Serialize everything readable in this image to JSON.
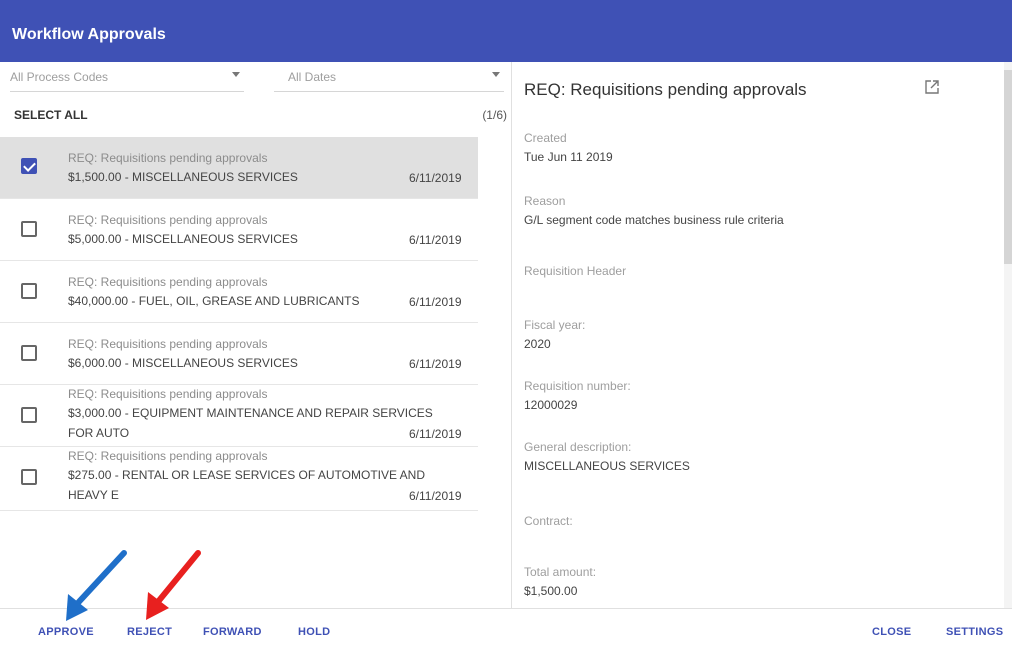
{
  "window": {
    "title": "Workflow Approvals"
  },
  "filters": {
    "process_codes": "All Process Codes",
    "dates": "All Dates"
  },
  "list": {
    "select_all": "SELECT ALL",
    "count": "(1/6)",
    "items": [
      {
        "subtitle": "REQ: Requisitions pending approvals",
        "line1": "$1,500.00 - MISCELLANEOUS SERVICES",
        "line2": "",
        "date": "6/11/2019",
        "checked": true
      },
      {
        "subtitle": "REQ: Requisitions pending approvals",
        "line1": "$5,000.00 - MISCELLANEOUS SERVICES",
        "line2": "",
        "date": "6/11/2019",
        "checked": false
      },
      {
        "subtitle": "REQ: Requisitions pending approvals",
        "line1": "$40,000.00 - FUEL, OIL, GREASE AND LUBRICANTS",
        "line2": "",
        "date": "6/11/2019",
        "checked": false
      },
      {
        "subtitle": "REQ: Requisitions pending approvals",
        "line1": "$6,000.00 - MISCELLANEOUS SERVICES",
        "line2": "",
        "date": "6/11/2019",
        "checked": false
      },
      {
        "subtitle": "REQ: Requisitions pending approvals",
        "line1": "$3,000.00 - EQUIPMENT MAINTENANCE AND REPAIR SERVICES",
        "line2": "FOR AUTO",
        "date": "6/11/2019",
        "checked": false
      },
      {
        "subtitle": "REQ: Requisitions pending approvals",
        "line1": "$275.00 - RENTAL OR LEASE SERVICES OF AUTOMOTIVE AND",
        "line2": "HEAVY E",
        "date": "6/11/2019",
        "checked": false
      }
    ]
  },
  "detail": {
    "title": "REQ: Requisitions pending approvals",
    "open_icon": "open-in-new-icon",
    "fields": [
      {
        "label": "Created",
        "value": "Tue Jun 11 2019"
      },
      {
        "label": "Reason",
        "value": "G/L segment code matches business rule criteria"
      },
      {
        "label": "Requisition Header",
        "value": ""
      },
      {
        "label": "Fiscal year:",
        "value": "2020"
      },
      {
        "label": "Requisition number:",
        "value": "12000029"
      },
      {
        "label": "General description:",
        "value": "MISCELLANEOUS SERVICES"
      },
      {
        "label": "Contract:",
        "value": ""
      },
      {
        "label": "Total amount:",
        "value": "$1,500.00"
      }
    ]
  },
  "actions": {
    "approve": "APPROVE",
    "reject": "REJECT",
    "forward": "FORWARD",
    "hold": "HOLD",
    "close": "CLOSE",
    "settings": "SETTINGS"
  },
  "colors": {
    "header": "#3f51b5",
    "accent": "#3f51b5",
    "arrow_blue": "#1f6fc9",
    "arrow_red": "#e8201f"
  }
}
